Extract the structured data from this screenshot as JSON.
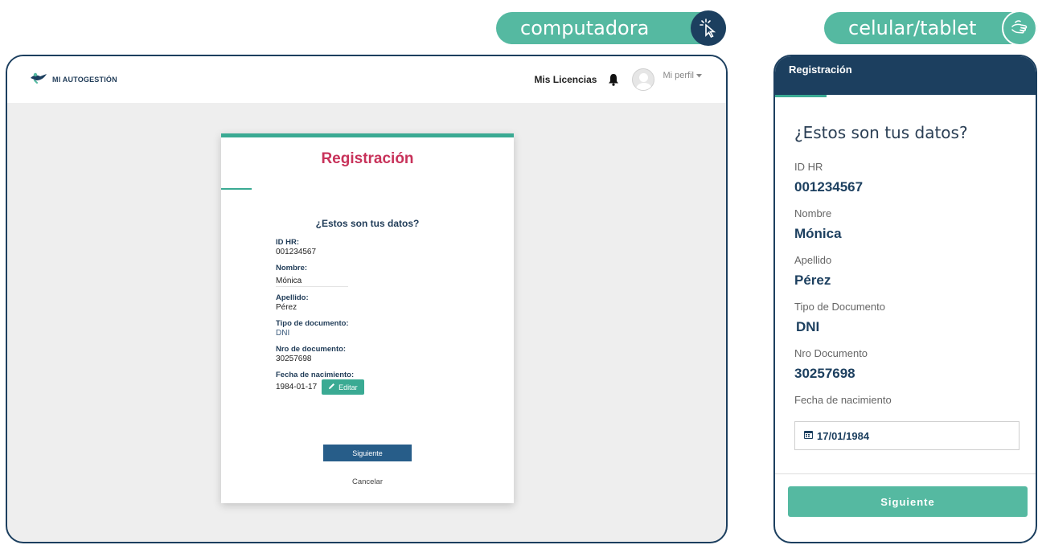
{
  "pills": {
    "desktop_label": "computadora",
    "desktop_icon": "cursor-click-icon",
    "mobile_label": "celular/tablet",
    "mobile_icon": "hand-tap-icon"
  },
  "desktop": {
    "brand": "MI AUTOGESTIÓN",
    "nav": {
      "licencias": "Mis Licencias",
      "profile": "Mi perfil"
    },
    "card": {
      "title": "Registración",
      "question": "¿Estos son tus datos?",
      "fields": [
        {
          "label": "ID HR:",
          "value": "001234567"
        },
        {
          "label": "Nombre:",
          "value": "Mónica"
        },
        {
          "label": "Apellido:",
          "value": "Pérez"
        },
        {
          "label": "Tipo de documento:",
          "value": "DNI"
        },
        {
          "label": "Nro de documento:",
          "value": "30257698"
        },
        {
          "label": "Fecha de nacimiento:",
          "value": "1984-01-17"
        }
      ],
      "edit_label": "Editar",
      "next_label": "Siguiente",
      "cancel_label": "Cancelar"
    }
  },
  "mobile": {
    "header": "Registración",
    "question": "¿Estos son tus datos?",
    "fields": [
      {
        "label": "ID HR",
        "value": "001234567"
      },
      {
        "label": "Nombre",
        "value": "Mónica"
      },
      {
        "label": "Apellido",
        "value": "Pérez"
      },
      {
        "label": "Tipo de Documento",
        "value": "DNI"
      },
      {
        "label": "Nro Documento",
        "value": "30257698"
      }
    ],
    "birth_label": "Fecha de nacimiento",
    "birth_value": "17/01/1984",
    "next_label": "Siguiente"
  },
  "colors": {
    "navy": "#1c3f5f",
    "teal": "#55b9a1",
    "accent_red": "#c8325a",
    "button_blue": "#275d89"
  }
}
